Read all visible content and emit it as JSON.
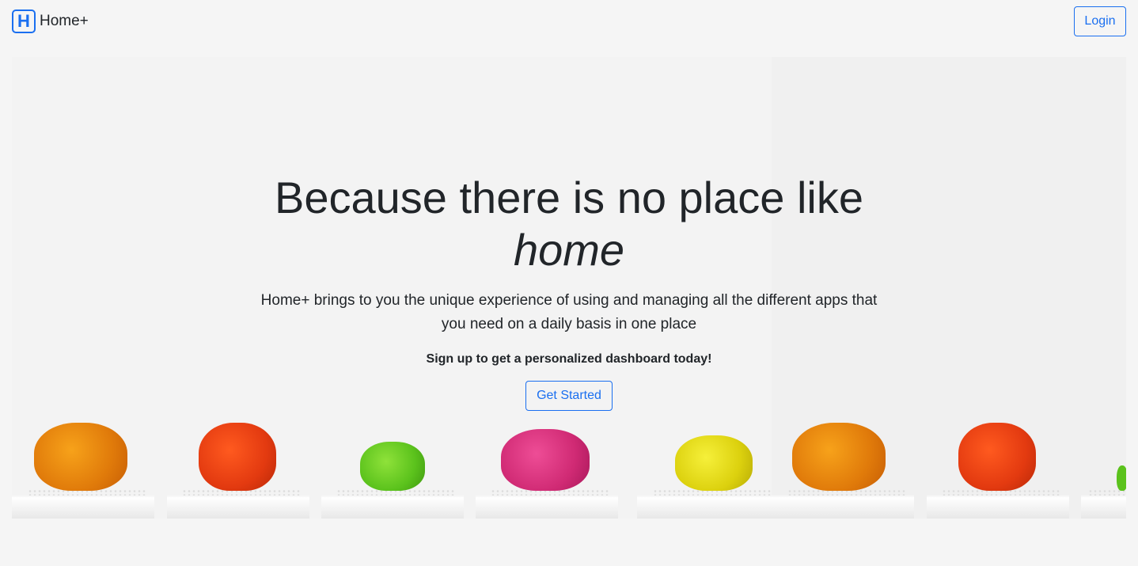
{
  "nav": {
    "logo_letter": "H",
    "brand": "Home+",
    "login_label": "Login"
  },
  "hero": {
    "title_line1": "Because there is no place like",
    "title_emphasis": "home",
    "subtitle": "Home+ brings to you the unique experience of using and managing all the different apps that you need on a daily basis in one place",
    "cta_text": "Sign up to get a personalized dashboard today!",
    "cta_button": "Get Started"
  },
  "colors": {
    "accent": "#1a6ff0",
    "background": "#f5f5f5",
    "text": "#212529"
  }
}
